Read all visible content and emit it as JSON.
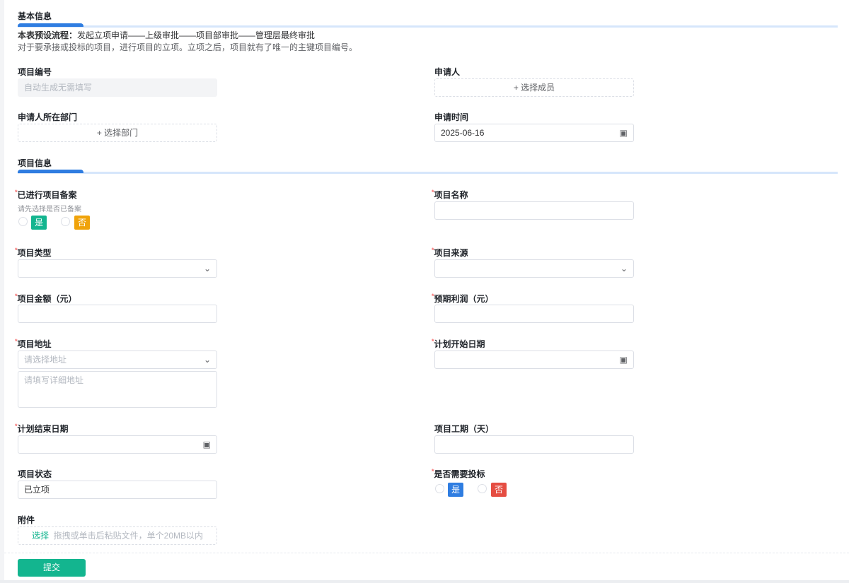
{
  "sections": {
    "basic": "基本信息",
    "project": "项目信息"
  },
  "intro": {
    "flow_label": "本表预设流程：",
    "flow": "发起立项申请——上级审批——项目部审批——管理层最终审批",
    "desc": "对于要承接或投标的项目，进行项目的立项。立项之后，项目就有了唯一的主键项目编号。"
  },
  "fields": {
    "project_no": {
      "label": "项目编号",
      "placeholder": "自动生成无需填写"
    },
    "applicant": {
      "label": "申请人",
      "button": "+ 选择成员"
    },
    "department": {
      "label": "申请人所在部门",
      "button": "+ 选择部门"
    },
    "apply_time": {
      "label": "申请时间",
      "value": "2025-06-16"
    },
    "filed": {
      "label": "已进行项目备案",
      "hint": "请先选择是否已备案",
      "options": [
        "是",
        "否"
      ]
    },
    "name": {
      "label": "项目名称"
    },
    "type": {
      "label": "项目类型"
    },
    "source": {
      "label": "项目来源"
    },
    "amount": {
      "label": "项目金额（元）"
    },
    "profit": {
      "label": "预期利润（元）"
    },
    "address": {
      "label": "项目地址",
      "select_placeholder": "请选择地址",
      "detail_placeholder": "请填写详细地址"
    },
    "start": {
      "label": "计划开始日期"
    },
    "end": {
      "label": "计划结束日期"
    },
    "duration": {
      "label": "项目工期（天）"
    },
    "status": {
      "label": "项目状态",
      "value": "已立项"
    },
    "bid": {
      "label": "是否需要投标",
      "options": [
        "是",
        "否"
      ]
    },
    "attachment": {
      "label": "附件",
      "select": "选择",
      "hint": "拖拽或单击后粘贴文件，单个20MB以内"
    }
  },
  "submit": "提交",
  "colors": {
    "accent": "#2f7de1",
    "green": "#13b58f",
    "orange": "#f0a30a",
    "blue": "#2f7de1",
    "red": "#e54d42"
  }
}
